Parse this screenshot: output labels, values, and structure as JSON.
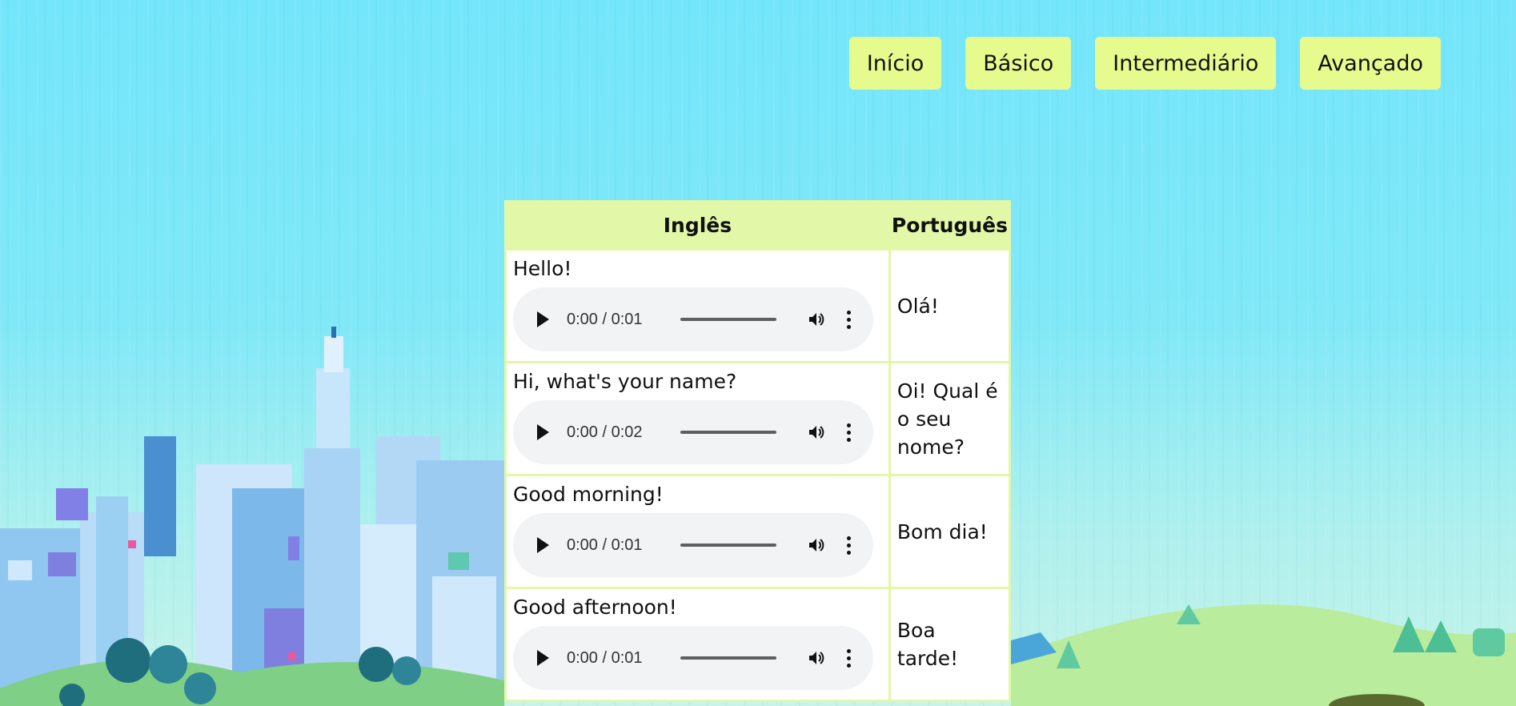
{
  "nav": {
    "items": [
      {
        "label": "Início"
      },
      {
        "label": "Básico"
      },
      {
        "label": "Intermediário"
      },
      {
        "label": "Avançado"
      }
    ]
  },
  "table": {
    "headers": {
      "english": "Inglês",
      "portuguese": "Português"
    },
    "rows": [
      {
        "english": "Hello!",
        "time": "0:00 / 0:01",
        "portuguese": "Olá!"
      },
      {
        "english": "Hi, what's your name?",
        "time": "0:00 / 0:02",
        "portuguese": "Oi! Qual é o seu nome?"
      },
      {
        "english": "Good morning!",
        "time": "0:00 / 0:01",
        "portuguese": "Bom dia!"
      },
      {
        "english": "Good afternoon!",
        "time": "0:00 / 0:01",
        "portuguese": "Boa tarde!"
      }
    ]
  },
  "colors": {
    "nav_button_bg": "#e6fb8e",
    "table_border": "#e2f7a8",
    "sky": "#74e6fb"
  },
  "icons": [
    "play-icon",
    "volume-icon",
    "more-options-icon"
  ]
}
